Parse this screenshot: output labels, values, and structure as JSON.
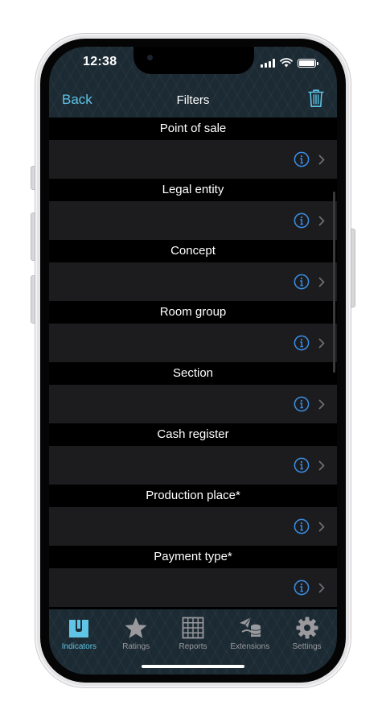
{
  "status_bar": {
    "time": "12:38"
  },
  "nav": {
    "back_label": "Back",
    "title": "Filters"
  },
  "filters": [
    {
      "label": "Point of sale"
    },
    {
      "label": "Legal entity"
    },
    {
      "label": "Concept"
    },
    {
      "label": "Room group"
    },
    {
      "label": "Section"
    },
    {
      "label": "Cash register"
    },
    {
      "label": "Production place*"
    },
    {
      "label": "Payment type*"
    }
  ],
  "tabs": [
    {
      "label": "Indicators",
      "icon": "indicators-icon",
      "active": true
    },
    {
      "label": "Ratings",
      "icon": "star-icon",
      "active": false
    },
    {
      "label": "Reports",
      "icon": "grid-icon",
      "active": false
    },
    {
      "label": "Extensions",
      "icon": "extensions-icon",
      "active": false
    },
    {
      "label": "Settings",
      "icon": "gear-icon",
      "active": false
    }
  ],
  "colors": {
    "accent": "#5fc4e6",
    "info": "#3a8ee6",
    "bar_bg": "#1c2a33",
    "row_bg": "#1c1c1e"
  }
}
